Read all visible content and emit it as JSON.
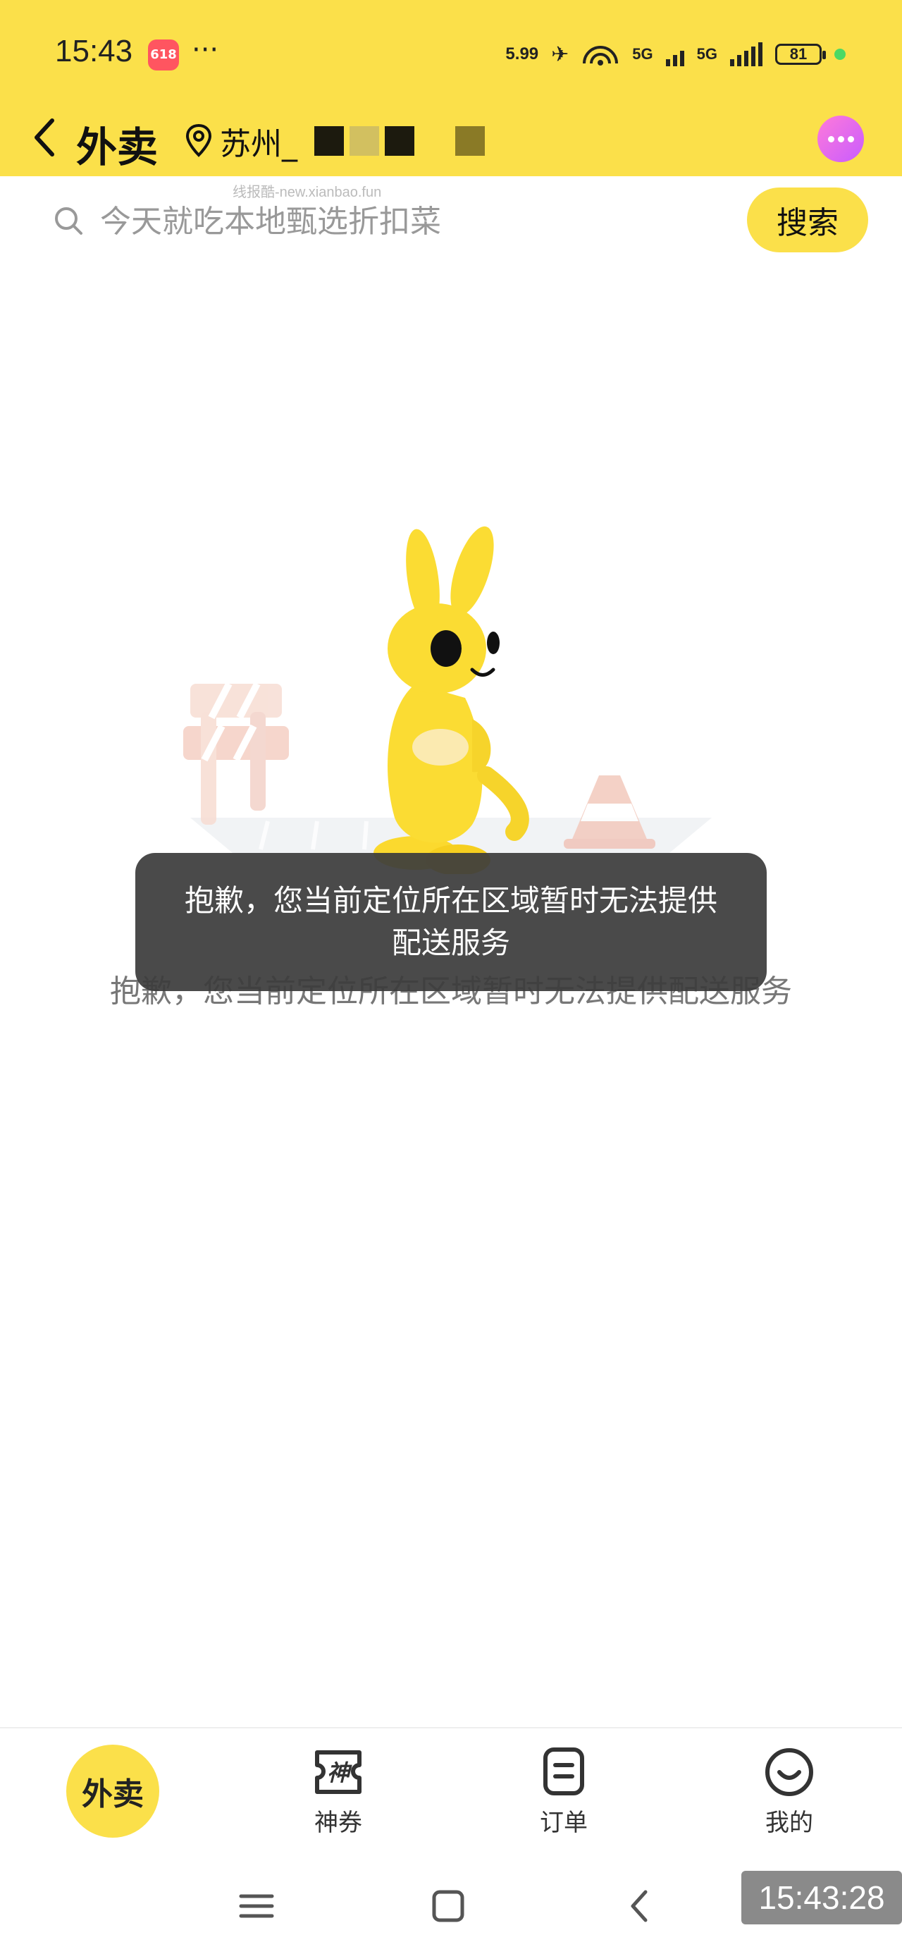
{
  "status_bar": {
    "time": "15:43",
    "app_badge": "618",
    "more": "···",
    "net_speed_value": "5.99",
    "net_type_1": "5G",
    "net_type_2": "5G",
    "battery": "81"
  },
  "header": {
    "title": "外卖",
    "location": "苏州_",
    "brand_color": "#fbe04a"
  },
  "watermark": "线报酷-new.xianbao.fun",
  "search": {
    "placeholder": "今天就吃本地甄选折扣菜",
    "button_label": "搜索"
  },
  "main": {
    "empty_message": "抱歉，您当前定位所在区域暂时无法提供配送服务"
  },
  "toast": {
    "message": "抱歉，您当前定位所在区域暂时无法提供配送服务"
  },
  "bottom_nav": {
    "items": [
      {
        "label": "外卖",
        "icon": "takeout-home-icon"
      },
      {
        "label": "神券",
        "icon": "coupon-icon"
      },
      {
        "label": "订单",
        "icon": "order-icon"
      },
      {
        "label": "我的",
        "icon": "profile-icon"
      }
    ]
  },
  "screenshot_clock": "15:43:28"
}
